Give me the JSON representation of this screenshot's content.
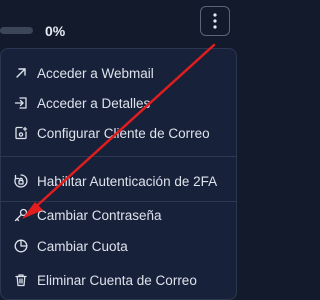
{
  "storage": {
    "percent_label": "0%",
    "progress_fraction": 0.0
  },
  "menu": {
    "items": [
      {
        "label": "Acceder a Webmail",
        "icon": "external-link-icon"
      },
      {
        "label": "Acceder a Detalles",
        "icon": "enter-details-icon"
      },
      {
        "label": "Configurar Cliente de Correo",
        "icon": "configure-client-icon"
      },
      {
        "label": "Habilitar Autenticación de 2FA",
        "icon": "two-factor-icon"
      },
      {
        "label": "Cambiar Contraseña",
        "icon": "key-icon"
      },
      {
        "label": "Cambiar Cuota",
        "icon": "pie-chart-icon"
      },
      {
        "label": "Eliminar Cuenta de Correo",
        "icon": "trash-icon"
      }
    ]
  },
  "annotation": {
    "arrow_color": "#e11d1d"
  },
  "colors": {
    "background": "#121a2b",
    "menu_background": "#18213a",
    "text": "#dde3ec",
    "accent": "#6aa7ff"
  }
}
